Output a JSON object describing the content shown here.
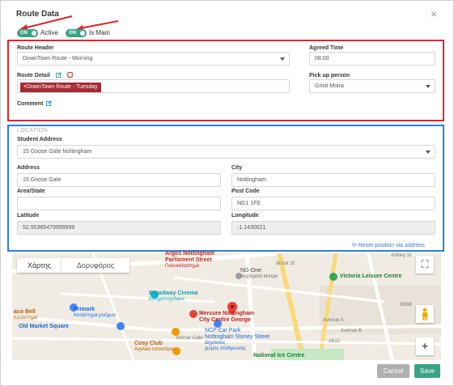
{
  "modal": {
    "title": "Route Data",
    "close_glyph": "×"
  },
  "toggles": {
    "active": {
      "state": "ON",
      "label": "Active"
    },
    "is_main": {
      "state": "ON",
      "label": "Is Main"
    }
  },
  "route": {
    "header_label": "Route Header",
    "header_value": "DownTown Route - Morning",
    "agreed_time_label": "Agreed Time",
    "agreed_time_value": "08:00",
    "detail_label": "Route Detail",
    "detail_tag": "×DownTown Route - Tuesday",
    "pickup_label": "Pick up person",
    "pickup_value": "Grixti Moira",
    "comment_label": "Comment"
  },
  "location": {
    "section_title": "LOCATION",
    "student_address_label": "Student Address",
    "student_address_value": "15 Goose Gate Nottingham",
    "address_label": "Address",
    "address_value": "15 Goose Gate",
    "city_label": "City",
    "city_value": "Nottingham",
    "area_label": "Area/State",
    "area_value": "",
    "postcode_label": "Post Code",
    "postcode_value": "NG1 1FE",
    "latitude_label": "Latitude",
    "latitude_value": "52.95385479999999",
    "longitude_label": "Longitude",
    "longitude_value": "-1.1430021",
    "reset_label": "Reset position via address"
  },
  "map": {
    "tab_map": "Χάρτης",
    "tab_satellite": "Δορυφόρος",
    "labels": [
      {
        "text": "Argos Nottingham"
      },
      {
        "text": "Parliament Street"
      },
      {
        "text": "Πολυκαταστημα"
      },
      {
        "text": "NG-One"
      },
      {
        "text": "Νυχτερινό κέντρο"
      },
      {
        "text": "Victoria Leisure Centre"
      },
      {
        "text": "Broadway Cinema"
      },
      {
        "text": "Κινηματογράφος"
      },
      {
        "text": "Primark"
      },
      {
        "text": "Κατάστημα ρούχων"
      },
      {
        "text": "Mercure Nottingham"
      },
      {
        "text": "City Centre George"
      },
      {
        "text": "Old Market Square"
      },
      {
        "text": "NCP Car Park"
      },
      {
        "text": "Nottingham Stoney Street"
      },
      {
        "text": "Δημόσιος"
      },
      {
        "text": "χώρος στάθμευσης"
      },
      {
        "text": "Cosy Club"
      },
      {
        "text": "Αγγλικό εστιατόριο"
      },
      {
        "text": "National Ice Centre"
      },
      {
        "text": "aco Bell"
      },
      {
        "text": "Κατάστημα"
      },
      {
        "text": "Warser Gate"
      },
      {
        "text": "Brook St"
      },
      {
        "text": "Ashley St"
      },
      {
        "text": "B686"
      },
      {
        "text": "Avenue A"
      },
      {
        "text": "Avenue B"
      },
      {
        "text": "A612"
      }
    ],
    "zoom_in": "+",
    "fullscreen_glyph": "⛶"
  },
  "footer": {
    "cancel_label": "Cancel",
    "save_label": "Save"
  },
  "colors": {
    "toggle_on": "#3aa287",
    "tag_bg": "#a52a33",
    "red_annotation": "#e0242f",
    "blue_annotation": "#2f7dd9",
    "save_bg": "#3aa287",
    "cancel_bg": "#b0b0b0"
  }
}
